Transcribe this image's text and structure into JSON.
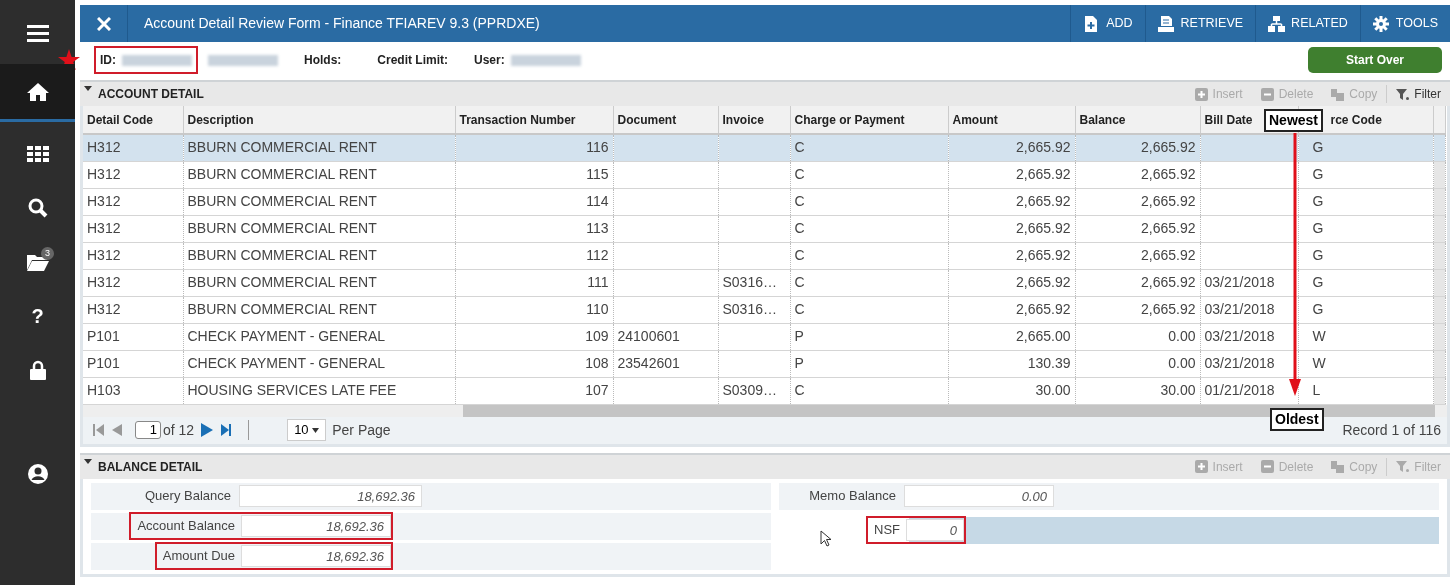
{
  "sidebar": {
    "items": [
      {
        "kind": "menu",
        "selected": false
      },
      {
        "kind": "home",
        "selected": true
      },
      {
        "kind": "apps",
        "selected": false
      },
      {
        "kind": "search",
        "selected": false
      },
      {
        "kind": "folder",
        "badge": "3",
        "selected": false
      },
      {
        "kind": "help",
        "label": "?",
        "selected": false
      },
      {
        "kind": "lock",
        "selected": false
      },
      {
        "kind": "user",
        "selected": false
      }
    ]
  },
  "header": {
    "title": "Account Detail Review Form - Finance TFIAREV 9.3 (PPRDXE)",
    "actions": [
      {
        "kind": "add",
        "label": "ADD"
      },
      {
        "kind": "retrieve",
        "label": "RETRIEVE"
      },
      {
        "kind": "related",
        "label": "RELATED"
      },
      {
        "kind": "tools",
        "label": "TOOLS"
      }
    ]
  },
  "info_bar": {
    "fields": [
      {
        "label": "ID:",
        "redacted": true,
        "highlighted": true
      },
      {
        "redacted": true,
        "highlighted": false
      },
      {
        "label": "Holds:",
        "redacted": false,
        "highlighted": false
      },
      {
        "label": "Credit Limit:",
        "redacted": false,
        "highlighted": false
      },
      {
        "label": "User:",
        "redacted": true,
        "highlighted": false
      }
    ],
    "start_over": "Start Over"
  },
  "account_detail": {
    "title": "ACCOUNT DETAIL",
    "expanded": true,
    "toolbar": [
      {
        "kind": "insert",
        "label": "Insert",
        "disabled": true
      },
      {
        "kind": "delete",
        "label": "Delete",
        "disabled": true
      },
      {
        "kind": "copy",
        "label": "Copy",
        "disabled": true
      },
      {
        "kind": "filter",
        "label": "Filter",
        "disabled": false
      }
    ],
    "table": {
      "columns": [
        {
          "label": "Detail Code",
          "kind": "text"
        },
        {
          "label": "Description",
          "kind": "text"
        },
        {
          "label": "Transaction Number",
          "kind": "number"
        },
        {
          "label": "Document",
          "kind": "text"
        },
        {
          "label": "Invoice",
          "kind": "text"
        },
        {
          "label": "Charge or Payment",
          "kind": "text"
        },
        {
          "label": "Amount",
          "kind": "number"
        },
        {
          "label": "Balance",
          "kind": "number"
        },
        {
          "label": "Bill Date",
          "kind": "text"
        },
        {
          "label": "rce Code",
          "kind": "text"
        }
      ],
      "rows": [
        {
          "selected": true,
          "cells": [
            "H312",
            "BBURN COMMERCIAL RENT",
            "116",
            "",
            "",
            "C",
            "2,665.92",
            "2,665.92",
            "",
            "G"
          ]
        },
        {
          "selected": false,
          "cells": [
            "H312",
            "BBURN COMMERCIAL RENT",
            "115",
            "",
            "",
            "C",
            "2,665.92",
            "2,665.92",
            "",
            "G"
          ]
        },
        {
          "selected": false,
          "cells": [
            "H312",
            "BBURN COMMERCIAL RENT",
            "114",
            "",
            "",
            "C",
            "2,665.92",
            "2,665.92",
            "",
            "G"
          ]
        },
        {
          "selected": false,
          "cells": [
            "H312",
            "BBURN COMMERCIAL RENT",
            "113",
            "",
            "",
            "C",
            "2,665.92",
            "2,665.92",
            "",
            "G"
          ]
        },
        {
          "selected": false,
          "cells": [
            "H312",
            "BBURN COMMERCIAL RENT",
            "112",
            "",
            "",
            "C",
            "2,665.92",
            "2,665.92",
            "",
            "G"
          ]
        },
        {
          "selected": false,
          "cells": [
            "H312",
            "BBURN COMMERCIAL RENT",
            "111",
            "",
            "S0316…",
            "C",
            "2,665.92",
            "2,665.92",
            "03/21/2018",
            "G"
          ]
        },
        {
          "selected": false,
          "cells": [
            "H312",
            "BBURN COMMERCIAL RENT",
            "110",
            "",
            "S0316…",
            "C",
            "2,665.92",
            "2,665.92",
            "03/21/2018",
            "G"
          ]
        },
        {
          "selected": false,
          "cells": [
            "P101",
            "CHECK PAYMENT - GENERAL",
            "109",
            "24100601",
            "",
            "P",
            "2,665.00",
            "0.00",
            "03/21/2018",
            "W"
          ]
        },
        {
          "selected": false,
          "cells": [
            "P101",
            "CHECK PAYMENT - GENERAL",
            "108",
            "23542601",
            "",
            "P",
            "130.39",
            "0.00",
            "03/21/2018",
            "W"
          ]
        },
        {
          "selected": false,
          "cells": [
            "H103",
            "HOUSING SERVICES LATE FEE",
            "107",
            "",
            "S0309…",
            "C",
            "30.00",
            "30.00",
            "01/21/2018",
            "L"
          ]
        }
      ]
    },
    "annotations": {
      "top": "Newest",
      "bottom": "Oldest"
    },
    "pagination": {
      "page": "1",
      "of": "of 12",
      "per_page": "10",
      "per_page_label": "Per Page",
      "record": "Record 1 of 116"
    }
  },
  "balance_detail": {
    "title": "BALANCE DETAIL",
    "expanded": true,
    "toolbar": [
      {
        "kind": "insert",
        "label": "Insert",
        "disabled": true
      },
      {
        "kind": "delete",
        "label": "Delete",
        "disabled": true
      },
      {
        "kind": "copy",
        "label": "Copy",
        "disabled": true
      },
      {
        "kind": "filter",
        "label": "Filter",
        "disabled": true
      }
    ],
    "left_fields": [
      {
        "label": "Query Balance",
        "value": "18,692.36",
        "highlighted": false,
        "selected": false
      },
      {
        "label": "Account Balance",
        "value": "18,692.36",
        "highlighted": true,
        "selected": false
      },
      {
        "label": "Amount Due",
        "value": "18,692.36",
        "highlighted": true,
        "selected": false
      }
    ],
    "right_fields": [
      {
        "label": "Memo Balance",
        "value": "0.00",
        "highlighted": false,
        "selected": false
      },
      {
        "label": "NSF",
        "value": "0",
        "highlighted": true,
        "selected": true
      }
    ]
  }
}
